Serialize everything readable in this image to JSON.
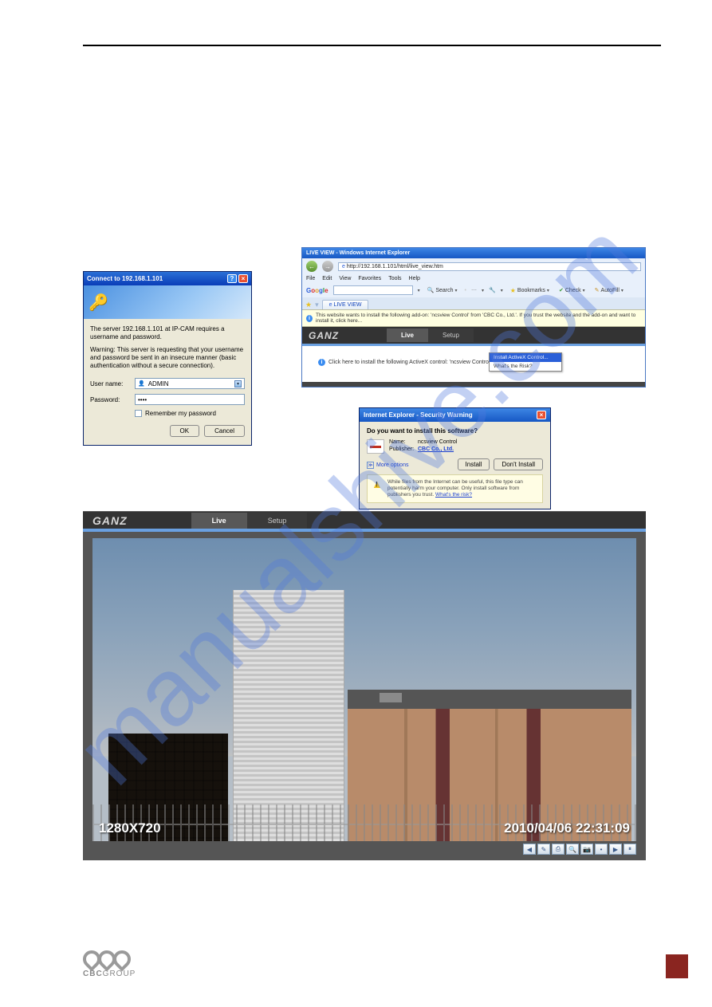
{
  "login": {
    "title": "Connect to 192.168.1.101",
    "server_msg": "The server 192.168.1.101 at IP-CAM requires a username and password.",
    "warning_msg": "Warning: This server is requesting that your username and password be sent in an insecure manner (basic authentication without a secure connection).",
    "username_label": "User name:",
    "username_value": "ADMIN",
    "password_label": "Password:",
    "password_value": "••••",
    "remember_label": "Remember my password",
    "ok_label": "OK",
    "cancel_label": "Cancel"
  },
  "ie": {
    "window_title": "LIVE VIEW - Windows Internet Explorer",
    "url": "http://192.168.1.101/html/live_view.htm",
    "menu": [
      "File",
      "Edit",
      "View",
      "Favorites",
      "Tools",
      "Help"
    ],
    "google_logo": "Google",
    "toolbar": {
      "search": "Search",
      "bookmarks": "Bookmarks",
      "check": "Check",
      "autofill": "AutoFill"
    },
    "tab_label": "LIVE VIEW",
    "infobar_text": "This website wants to install the following add-on: 'ncsview Control' from 'CBC Co., Ltd.'. If you trust the website and the add-on and want to install it, click here...",
    "cam": {
      "logo": "GANZ",
      "tabs": {
        "live": "Live",
        "setup": "Setup"
      },
      "prompt_text": "Click here to install the following ActiveX control: 'ncsview Control' from 'CBC Co., Ltd.'.",
      "menu_install": "Install ActiveX Control...",
      "menu_risk": "What's the Risk?"
    }
  },
  "security": {
    "title": "Internet Explorer - Security Warning",
    "question": "Do you want to install this software?",
    "name_label": "Name:",
    "name_value": "ncsview Control",
    "publisher_label": "Publisher:",
    "publisher_value": "CBC Co., Ltd.",
    "more_options": "More options",
    "install_label": "Install",
    "dont_install_label": "Don't Install",
    "warn_text": "While files from the Internet can be useful, this file type can potentially harm your computer. Only install software from publishers you trust.",
    "whats_risk": "What's the risk?"
  },
  "mainview": {
    "logo": "GANZ",
    "tabs": {
      "live": "Live",
      "setup": "Setup"
    },
    "osd_resolution": "1280X720",
    "osd_timestamp": "2010/04/06 22:31:09",
    "tool_icons": [
      "◀",
      "✎",
      "⎙",
      "🔍",
      "📷",
      "•",
      "▶",
      "⏸"
    ]
  },
  "footer": {
    "logo_text_bold": "CBC",
    "logo_text": "GROUP"
  }
}
